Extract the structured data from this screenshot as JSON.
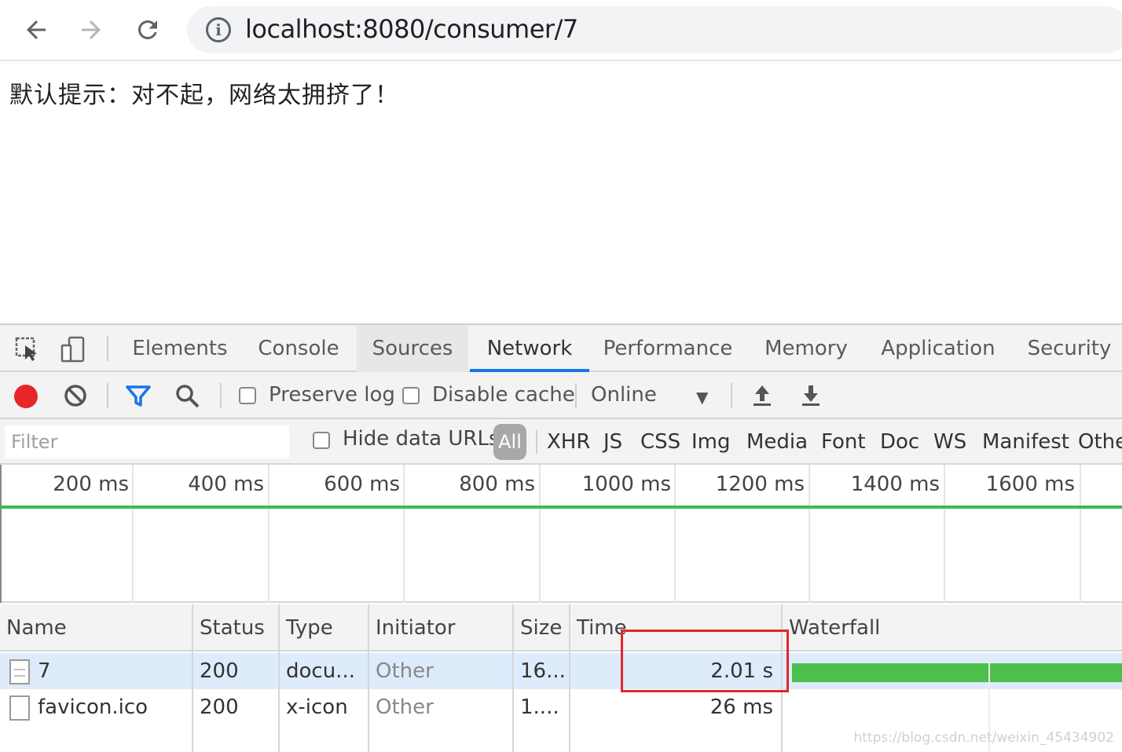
{
  "browser": {
    "back_icon": "arrow-left-icon",
    "forward_icon": "arrow-right-icon",
    "reload_icon": "reload-icon",
    "url": "localhost:8080/consumer/7"
  },
  "page": {
    "message": "默认提示：对不起，网络太拥挤了！"
  },
  "devtools": {
    "tabs": [
      "Elements",
      "Console",
      "Sources",
      "Network",
      "Performance",
      "Memory",
      "Application",
      "Security"
    ],
    "active_tab": "Network",
    "accent_color": "#1a73e8",
    "toolbar": {
      "preserve_log": "Preserve log",
      "disable_cache": "Disable cache",
      "throttling": "Online"
    },
    "filter": {
      "placeholder": "Filter",
      "hide_data_urls": "Hide data URLs",
      "all": "All",
      "types": [
        "XHR",
        "JS",
        "CSS",
        "Img",
        "Media",
        "Font",
        "Doc",
        "WS",
        "Manifest",
        "Othe"
      ]
    },
    "overview": {
      "ticks": [
        "200 ms",
        "400 ms",
        "600 ms",
        "800 ms",
        "1000 ms",
        "1200 ms",
        "1400 ms",
        "1600 ms"
      ]
    },
    "table": {
      "headers": {
        "name": "Name",
        "status": "Status",
        "type": "Type",
        "initiator": "Initiator",
        "size": "Size",
        "time": "Time",
        "waterfall": "Waterfall"
      },
      "rows": [
        {
          "name": "7",
          "status": "200",
          "type": "docu...",
          "initiator": "Other",
          "size": "16...",
          "time": "2.01 s"
        },
        {
          "name": "favicon.ico",
          "status": "200",
          "type": "x-icon",
          "initiator": "Other",
          "size": "1....",
          "time": "26 ms"
        }
      ]
    }
  },
  "watermark": "https://blog.csdn.net/weixin_45434902"
}
